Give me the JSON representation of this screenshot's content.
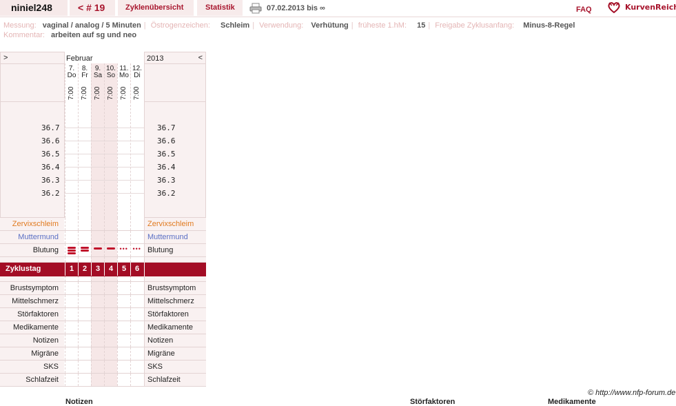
{
  "nav": {
    "user": "niniel248",
    "cycle": "< # 19",
    "overview": "Zyklenübersicht",
    "statistics": "Statistik",
    "date_range": "07.02.2013 bis ∞",
    "faq": "FAQ",
    "brand": "KurvenReich",
    "printer_icon": "printer-icon",
    "brand_icon": "heart-logo-icon"
  },
  "meta": {
    "messung_label": "Messung:",
    "messung_value": "vaginal / analog / 5 Minuten",
    "oestrogen_label": "Östrogenzeichen:",
    "oestrogen_value": "Schleim",
    "verwendung_label": "Verwendung:",
    "verwendung_value": "Verhütung",
    "hm_label": "früheste 1.hM:",
    "hm_value": "15",
    "freigabe_label": "Freigabe Zyklusanfang:",
    "freigabe_value": "Minus-8-Regel",
    "kommentar_label": "Kommentar:",
    "kommentar_value": "arbeiten auf sg und neo"
  },
  "chart_header": {
    "prev": ">",
    "month": "Februar",
    "year": "2013",
    "next": "<",
    "days": [
      {
        "date": "7.",
        "dow": "Do",
        "time": "7:00"
      },
      {
        "date": "8.",
        "dow": "Fr",
        "time": "7:00"
      },
      {
        "date": "9.",
        "dow": "Sa",
        "time": "7:00"
      },
      {
        "date": "10.",
        "dow": "So",
        "time": "7:00"
      },
      {
        "date": "11.",
        "dow": "Mo",
        "time": "7:00"
      },
      {
        "date": "12.",
        "dow": "Di",
        "time": "7:00"
      }
    ]
  },
  "temperatures": [
    "36.7",
    "36.6",
    "36.5",
    "36.4",
    "36.3",
    "36.2"
  ],
  "rows": {
    "zervix": "Zervixschleim",
    "muttermund": "Muttermund",
    "blutung": "Blutung",
    "zyklustag": "Zyklustag",
    "zyklustag_values": [
      "1",
      "2",
      "3",
      "4",
      "5",
      "6"
    ],
    "symptoms": [
      "Brustsymptom",
      "Mittelschmerz",
      "Störfaktoren",
      "Medikamente",
      "Notizen",
      "Migräne",
      "SKS",
      "Schlafzeit"
    ]
  },
  "bleeding": [
    "heavy",
    "medium",
    "light",
    "light",
    "spotting",
    "spotting"
  ],
  "colors": {
    "accent": "#a30d25",
    "zervix": "#e07a1f",
    "muttermund": "#5a6fc4"
  },
  "footer": "© http://www.nfp-forum.de",
  "bottom_cut": [
    "Notizen",
    "Störfaktoren",
    "Medikamente"
  ]
}
